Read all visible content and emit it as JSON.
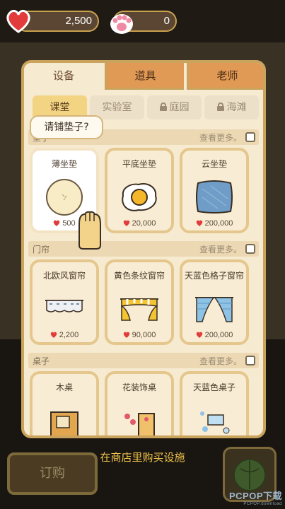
{
  "topbar": {
    "hearts_value": "2,500",
    "paws_value": "0",
    "icons": {
      "hearts": "heart-icon",
      "paws": "paw-print-icon"
    }
  },
  "tabs": [
    {
      "label": "设备",
      "active": true
    },
    {
      "label": "道具",
      "active": false
    },
    {
      "label": "老师",
      "active": false
    }
  ],
  "subtabs": [
    {
      "label": "课堂",
      "active": true,
      "locked": false
    },
    {
      "label": "实验室",
      "active": false,
      "locked": false
    },
    {
      "label": "庭园",
      "active": false,
      "locked": true
    },
    {
      "label": "海滩",
      "active": false,
      "locked": true
    }
  ],
  "tooltip": "请铺垫子?",
  "sections": [
    {
      "title": "垫子",
      "more": "查看更多。",
      "items": [
        {
          "name": "薄坐垫",
          "price": "500",
          "icon": "thin-cushion-icon",
          "selected": true
        },
        {
          "name": "平底坐垫",
          "price": "20,000",
          "icon": "fried-egg-cushion-icon",
          "selected": false
        },
        {
          "name": "云坐垫",
          "price": "200,000",
          "icon": "cloud-cushion-icon",
          "selected": false
        }
      ]
    },
    {
      "title": "门帘",
      "more": "查看更多。",
      "items": [
        {
          "name": "北欧风窗帘",
          "price": "2,200",
          "icon": "nordic-curtain-icon"
        },
        {
          "name": "黄色条纹窗帘",
          "price": "90,000",
          "icon": "yellow-stripe-curtain-icon"
        },
        {
          "name": "天蓝色格子窗帘",
          "price": "200,000",
          "icon": "sky-blue-check-curtain-icon"
        }
      ]
    },
    {
      "title": "桌子",
      "more": "查看更多。",
      "items": [
        {
          "name": "木桌",
          "icon": "wooden-desk-icon"
        },
        {
          "name": "花装饰桌",
          "icon": "flower-desk-icon"
        },
        {
          "name": "天蓝色桌子",
          "icon": "sky-blue-desk-icon"
        }
      ]
    }
  ],
  "hint": "在商店里购买设施",
  "order_button": "订购",
  "watermark": {
    "main": "PCPOP下载",
    "sub": "PCPOP.download"
  },
  "colors": {
    "accent": "#caa35c",
    "heart": "#e23b3b",
    "hint": "#f1c44a"
  }
}
